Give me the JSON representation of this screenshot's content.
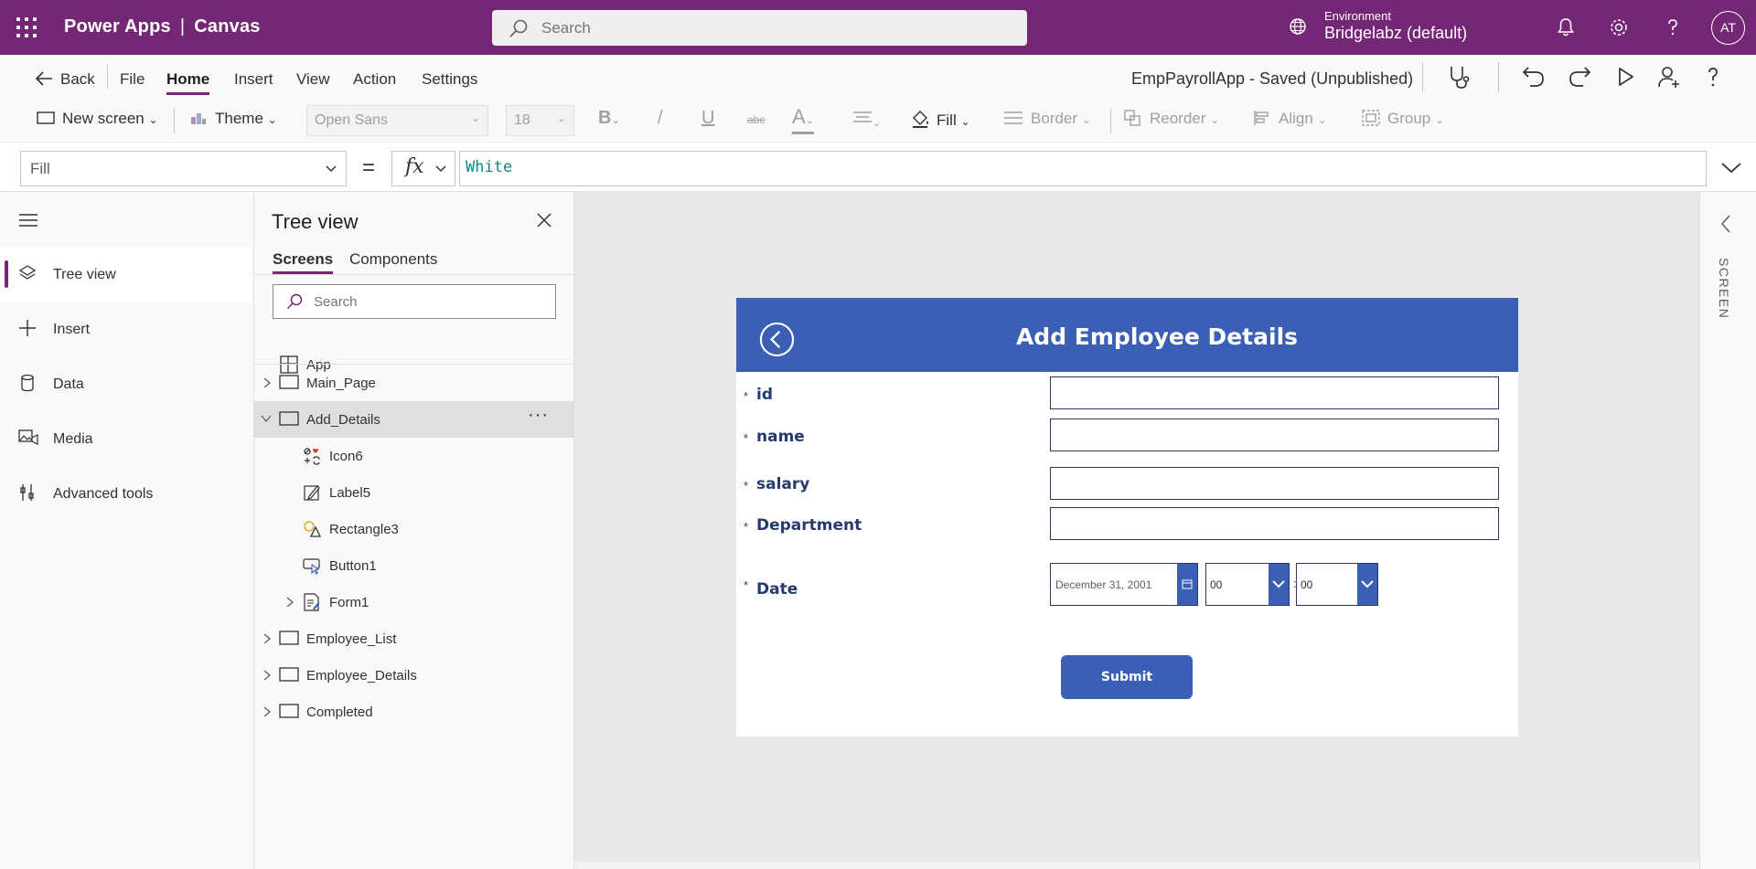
{
  "header": {
    "product": "Power Apps",
    "separator": "|",
    "app_type": "Canvas",
    "search_placeholder": "Search",
    "environment_label": "Environment",
    "environment_value": "Bridgelabz (default)",
    "avatar_initials": "AT"
  },
  "command_bar": {
    "back": "Back",
    "tabs": [
      "File",
      "Home",
      "Insert",
      "View",
      "Action",
      "Settings"
    ],
    "active_tab": "Home",
    "status": "EmpPayrollApp - Saved (Unpublished)"
  },
  "ribbon": {
    "new_screen": "New screen",
    "theme": "Theme",
    "font": "Open Sans",
    "font_size": "18",
    "bold": "B",
    "italic": "/",
    "underline": "U",
    "strike": "abc",
    "font_color": "A",
    "fill": "Fill",
    "border": "Border",
    "reorder": "Reorder",
    "align": "Align",
    "group": "Group"
  },
  "formula_bar": {
    "property": "Fill",
    "equals": "=",
    "fx": "fx",
    "formula": "White"
  },
  "left_rail": {
    "items": [
      "Tree view",
      "Insert",
      "Data",
      "Media",
      "Advanced tools"
    ],
    "active": "Tree view"
  },
  "tree_view": {
    "title": "Tree view",
    "tabs": [
      "Screens",
      "Components"
    ],
    "active_tab": "Screens",
    "search_placeholder": "Search",
    "app_node": "App",
    "nodes": [
      {
        "label": "Main_Page"
      },
      {
        "label": "Add_Details",
        "selected": true
      },
      {
        "label": "Icon6"
      },
      {
        "label": "Label5"
      },
      {
        "label": "Rectangle3"
      },
      {
        "label": "Button1"
      },
      {
        "label": "Form1"
      },
      {
        "label": "Employee_List"
      },
      {
        "label": "Employee_Details"
      },
      {
        "label": "Completed"
      }
    ],
    "more": "···"
  },
  "canvas": {
    "title": "Add Employee Details",
    "required_mark": "*",
    "fields": [
      "id",
      "name",
      "salary",
      "Department",
      "Date"
    ],
    "date_value": "December 31, 2001",
    "hour": "00",
    "minute": "00",
    "time_separator": ":",
    "submit": "Submit"
  },
  "right_rail": {
    "label": "SCREEN"
  },
  "colors": {
    "header": "#742774",
    "accent": "#742774",
    "app_blue": "#3a5fb4",
    "label_navy": "#253b6e",
    "formula_text": "#0b8a84"
  }
}
